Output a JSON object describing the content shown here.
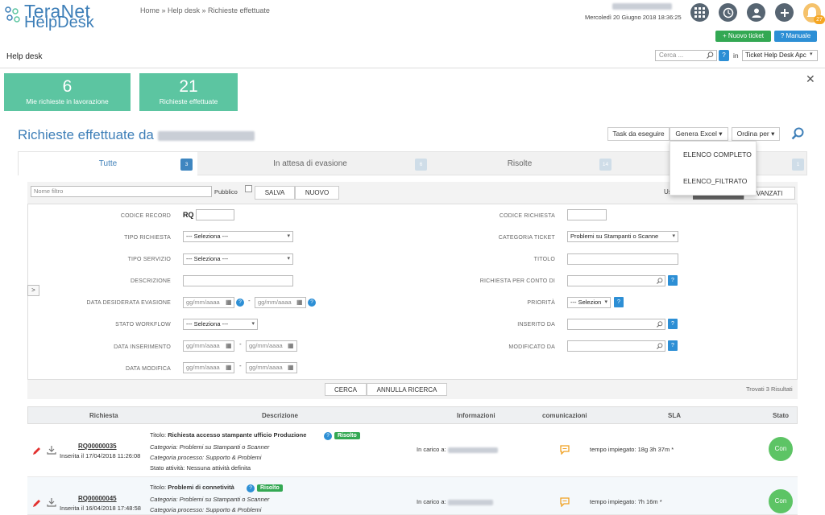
{
  "header": {
    "logo_line1": "TeraNet",
    "logo_line2": "HelpDesk",
    "breadcrumb": "Home » Help desk » Richieste effettuate",
    "date": "Mercoledì 20 Giugno 2018 18:36:25",
    "notif_count": "27",
    "new_ticket_label": "+ Nuovo ticket",
    "manual_label": "? Manuale",
    "section": "Help desk",
    "search_placeholder": "Cerca ...",
    "search_in": "in",
    "search_scope": "Ticket Help Desk Apc"
  },
  "counters": [
    {
      "value": "6",
      "label": "Mie richieste in lavorazione"
    },
    {
      "value": "21",
      "label": "Richieste effettuate"
    }
  ],
  "page": {
    "title": "Richieste effettuate da",
    "btn_task": "Task da eseguire",
    "btn_excel": "Genera Excel ▾",
    "btn_order": "Ordina per ▾"
  },
  "dropdown": [
    "ELENCO COMPLETO",
    "ELENCO_FILTRATO"
  ],
  "tabs": [
    {
      "label": "Tutte",
      "count": "3"
    },
    {
      "label": "In attesa di evasione",
      "count": "6"
    },
    {
      "label": "Risolte",
      "count": "14"
    },
    {
      "label": "",
      "count": "1"
    }
  ],
  "filter": {
    "name_placeholder": "Nome filtro",
    "public_label": "Pubblico",
    "save": "SALVA",
    "new": "NUOVO",
    "us_label": "Us",
    "advanced": "VANZATI",
    "search": "CERCA",
    "cancel": "ANNULLA RICERCA",
    "found": "Trovati 3 Risultati",
    "date_placeholder": "gg/mm/aaaa",
    "select_placeholder": "--- Seleziona ---",
    "select_short": "--- Selezion",
    "left_labels": [
      "CODICE RECORD",
      "TIPO RICHIESTA",
      "TIPO SERVIZIO",
      "DESCRIZIONE",
      "DATA DESIDERATA EVASIONE",
      "STATO WORKFLOW",
      "DATA INSERIMENTO",
      "DATA MODIFICA"
    ],
    "right_labels": [
      "CODICE RICHIESTA",
      "CATEGORIA TICKET",
      "TITOLO",
      "RICHIESTA PER CONTO DI",
      "PRIORITÀ",
      "INSERITO DA",
      "MODIFICATO DA"
    ],
    "rq_prefix": "RQ",
    "category_value": "Problemi su  Stampanti o Scanne"
  },
  "table": {
    "headers": [
      "Richiesta",
      "Descrizione",
      "Informazioni",
      "comunicazioni",
      "SLA",
      "Stato"
    ],
    "rows": [
      {
        "code": "RQ00000035",
        "inserted": "Inserita il 17/04/2018 11:26:08",
        "title_label": "Titolo:",
        "title": "Richiesta accesso stampante ufficio Produzione",
        "badge": "Risolto",
        "category": "Categoria: Problemi su Stampanti o Scanner",
        "process": "Categoria processo: Supporto & Problemi",
        "activity": "Stato attività:  Nessuna attività definita",
        "carico": "In carico a:",
        "sla": "tempo impiegato: 18g 3h 37m *",
        "state": "Con"
      },
      {
        "code": "RQ00000045",
        "inserted": "Inserita il 16/04/2018 17:48:58",
        "title_label": "Titolo:",
        "title": "Problemi di connetività",
        "badge": "Risolto",
        "category": "Categoria: Problemi su Stampanti o Scanner",
        "process": "Categoria processo: Supporto & Problemi",
        "activity": "",
        "carico": "In carico a:",
        "sla": "tempo impiegato: 7h 16m *",
        "state": "Con"
      }
    ]
  }
}
